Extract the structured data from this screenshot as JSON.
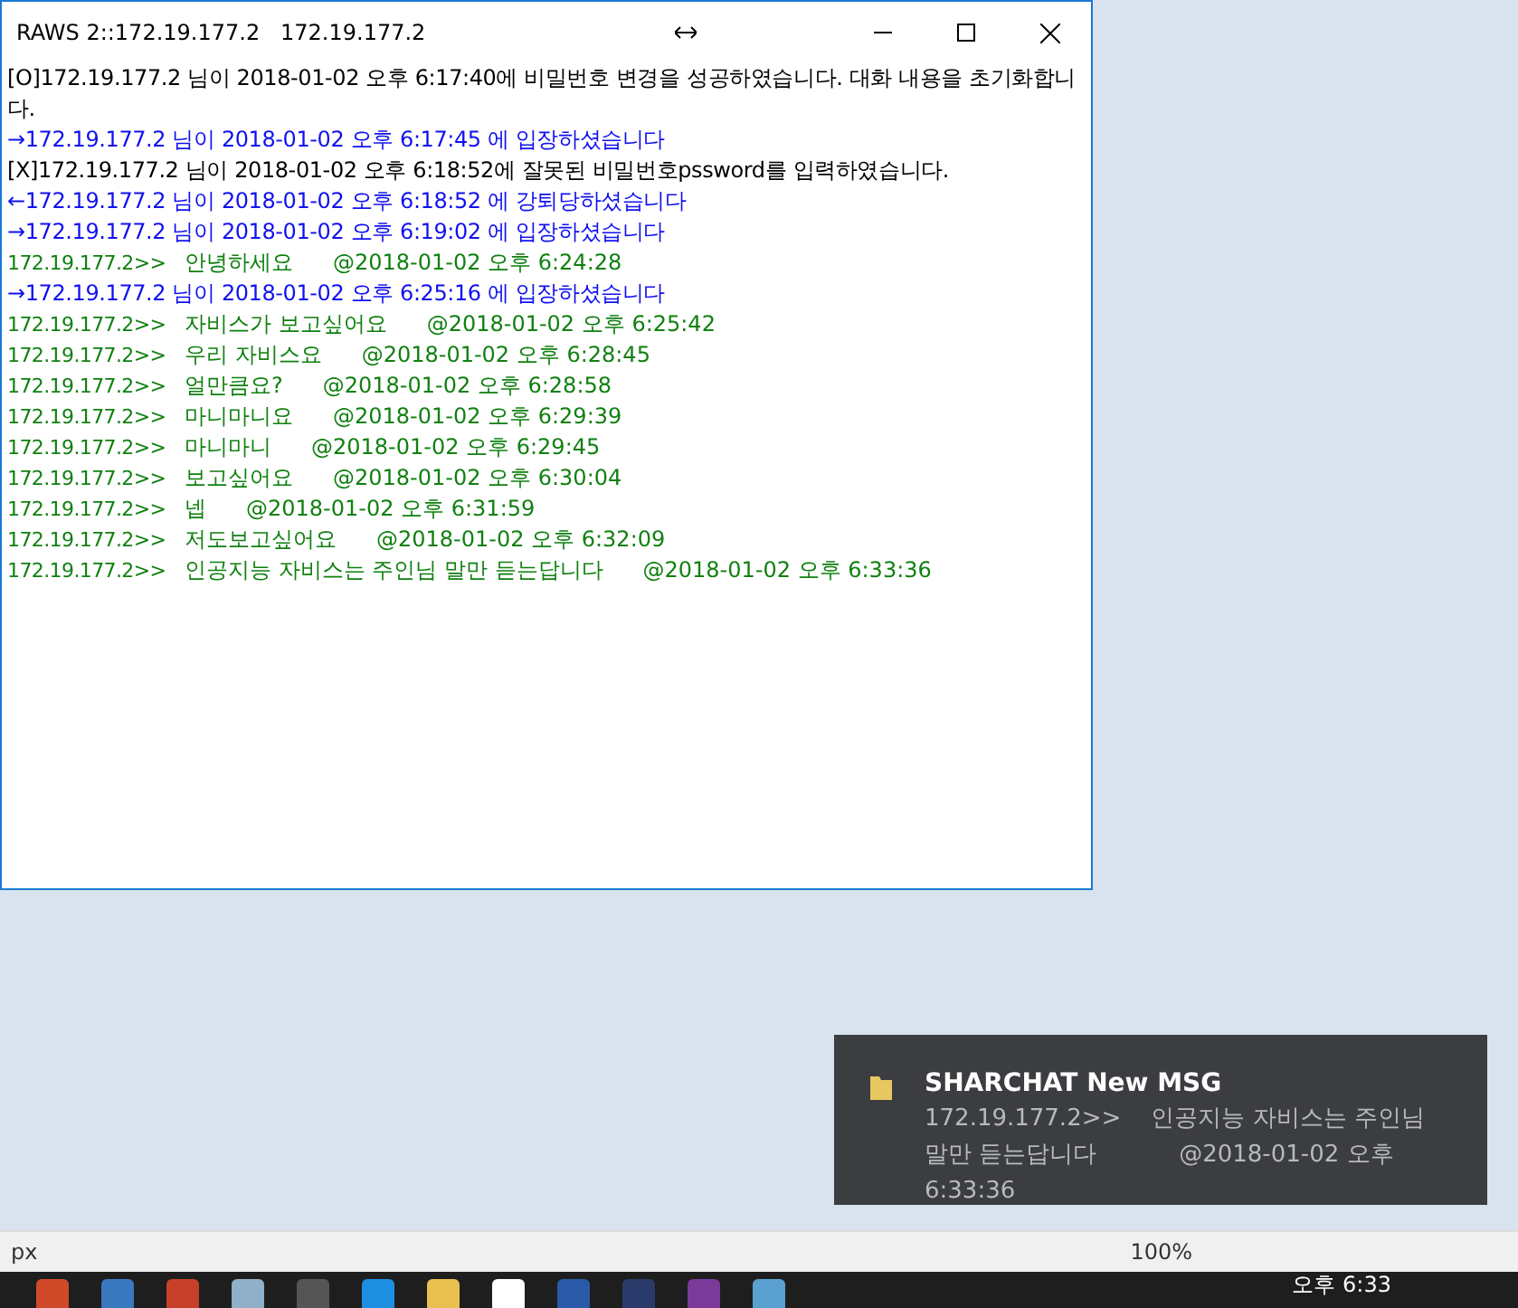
{
  "window": {
    "title": "RAWS 2::172.19.177.2   172.19.177.2"
  },
  "messages": [
    {
      "kind": "system",
      "text": "[O]172.19.177.2 님이 2018-01-02 오후 6:17:40에 비밀번호 변경을 성공하였습니다. 대화 내용을 초기화합니다."
    },
    {
      "kind": "join",
      "text": "→172.19.177.2 님이 2018-01-02 오후 6:17:45 에 입장하셨습니다"
    },
    {
      "kind": "system",
      "text": "[X]172.19.177.2 님이 2018-01-02 오후 6:18:52에 잘못된 비밀번호pssword를 입력하였습니다."
    },
    {
      "kind": "join",
      "text": "←172.19.177.2 님이 2018-01-02 오후 6:18:52 에 강퇴당하셨습니다"
    },
    {
      "kind": "join",
      "text": "→172.19.177.2 님이 2018-01-02 오후 6:19:02 에 입장하셨습니다"
    },
    {
      "kind": "chat",
      "sender": "172.19.177.2>>",
      "message": "안녕하세요",
      "time": "@2018-01-02 오후 6:24:28"
    },
    {
      "kind": "join",
      "text": "→172.19.177.2 님이 2018-01-02 오후 6:25:16 에 입장하셨습니다"
    },
    {
      "kind": "chat",
      "sender": "172.19.177.2>>",
      "message": "자비스가 보고싶어요",
      "time": "@2018-01-02 오후 6:25:42"
    },
    {
      "kind": "chat",
      "sender": "172.19.177.2>>",
      "message": "우리 자비스요",
      "time": "@2018-01-02 오후 6:28:45"
    },
    {
      "kind": "chat",
      "sender": "172.19.177.2>>",
      "message": "얼만큼요?",
      "time": "@2018-01-02 오후 6:28:58"
    },
    {
      "kind": "chat",
      "sender": "172.19.177.2>>",
      "message": "마니마니요",
      "time": "@2018-01-02 오후 6:29:39"
    },
    {
      "kind": "chat",
      "sender": "172.19.177.2>>",
      "message": "마니마니",
      "time": "@2018-01-02 오후 6:29:45"
    },
    {
      "kind": "chat",
      "sender": "172.19.177.2>>",
      "message": "보고싶어요",
      "time": "@2018-01-02 오후 6:30:04"
    },
    {
      "kind": "chat",
      "sender": "172.19.177.2>>",
      "message": "넵",
      "time": "@2018-01-02 오후 6:31:59"
    },
    {
      "kind": "chat",
      "sender": "172.19.177.2>>",
      "message": "저도보고싶어요",
      "time": "@2018-01-02 오후 6:32:09"
    },
    {
      "kind": "chat",
      "sender": "172.19.177.2>>",
      "message": "인공지능 자비스는 주인님 말만 듣는답니다",
      "time": "@2018-01-02 오후 6:33:36"
    }
  ],
  "status_bar": {
    "unit": "px",
    "zoom": "100%"
  },
  "notification": {
    "title": "SHARCHAT New MSG",
    "body": "172.19.177.2>>    인공지능 자비스는 주인님 말만 듣는답니다           @2018-01-02 오후 6:33:36"
  },
  "taskbar": {
    "clock": "오후 6:33"
  }
}
